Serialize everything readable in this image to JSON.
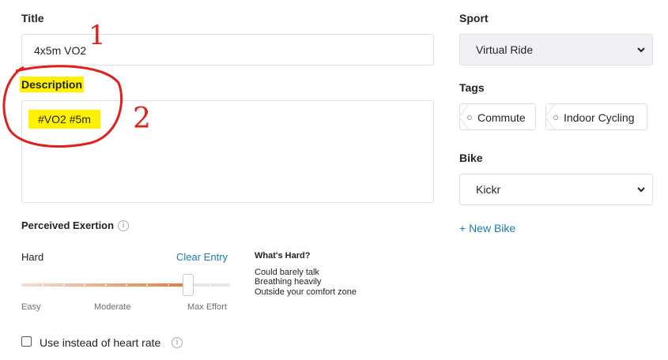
{
  "title": {
    "label": "Title",
    "value": "4x5m VO2"
  },
  "description": {
    "label": "Description",
    "value": "#VO2 #5m"
  },
  "sport": {
    "label": "Sport",
    "selected": "Virtual Ride"
  },
  "tags": {
    "label": "Tags",
    "items": [
      "Commute",
      "Indoor Cycling"
    ]
  },
  "bike": {
    "label": "Bike",
    "selected": "Kickr",
    "new_bike_label": "+ New Bike"
  },
  "exertion": {
    "label": "Perceived Exertion",
    "current_level": "Hard",
    "clear_label": "Clear Entry",
    "scale": {
      "min_label": "Easy",
      "mid_label": "Moderate",
      "max_label": "Max Effort"
    },
    "slider_value": 0.8,
    "help_title": "What's Hard?",
    "help_lines": [
      "Could barely talk",
      "Breathing heavily",
      "Outside your comfort zone"
    ]
  },
  "heart_rate": {
    "checkbox_label": "Use instead of heart rate",
    "checked": false
  },
  "annotations": {
    "one": "1",
    "two": "2"
  },
  "colors": {
    "accent_link": "#1a7fa8",
    "slider_fill": "#e07b3c",
    "highlight": "#fff200",
    "annotation": "#e0201b"
  }
}
